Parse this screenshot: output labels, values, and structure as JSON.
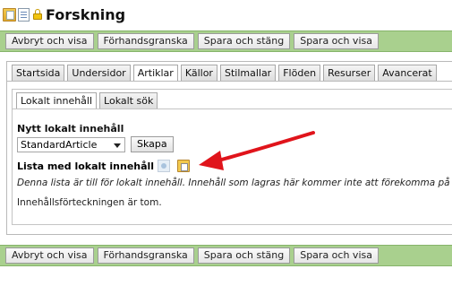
{
  "header": {
    "title": "Forskning"
  },
  "actions": {
    "cancel_view": "Avbryt och visa",
    "preview": "Förhandsgranska",
    "save_close": "Spara och stäng",
    "save_view": "Spara och visa"
  },
  "tabs": [
    {
      "label": "Startsida"
    },
    {
      "label": "Undersidor"
    },
    {
      "label": "Artiklar",
      "active": true
    },
    {
      "label": "Källor"
    },
    {
      "label": "Stilmallar"
    },
    {
      "label": "Flöden"
    },
    {
      "label": "Resurser"
    },
    {
      "label": "Avancerat"
    }
  ],
  "subtabs": [
    {
      "label": "Lokalt innehåll",
      "active": true
    },
    {
      "label": "Lokalt sök"
    }
  ],
  "new_local": {
    "heading": "Nytt lokalt innehåll",
    "select_value": "StandardArticle",
    "create_label": "Skapa"
  },
  "list_local": {
    "heading": "Lista med lokalt innehåll",
    "description": "Denna lista är till för lokalt innehåll. Innehåll som lagras här kommer inte att förekomma på",
    "empty_text": "Innehållsförteckningen är tom."
  },
  "colors": {
    "action_bar": "#a9d08e",
    "arrow": "#e0141b"
  }
}
